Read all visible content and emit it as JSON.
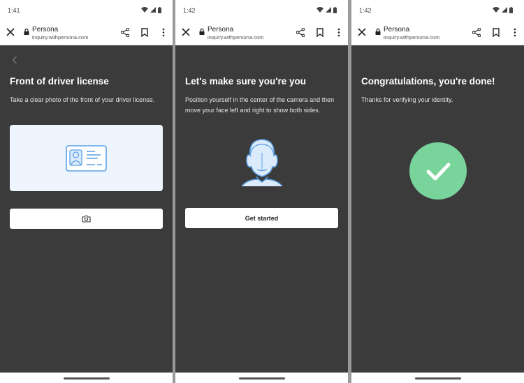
{
  "screens": [
    {
      "time": "1:41",
      "browser": {
        "title": "Persona",
        "url": "inquiry.withpersona.com"
      },
      "heading": "Front of driver license",
      "body": "Take a clear photo of the front of your driver license.",
      "illustration": "id-card-icon",
      "action_icon": "camera-icon"
    },
    {
      "time": "1:42",
      "browser": {
        "title": "Persona",
        "url": "inquiry.withpersona.com"
      },
      "heading": "Let's make sure you're you",
      "body": "Position yourself in the center of the camera and then move your face left and right to show both sides.",
      "illustration": "face-icon",
      "button_label": "Get started"
    },
    {
      "time": "1:42",
      "browser": {
        "title": "Persona",
        "url": "inquiry.withpersona.com"
      },
      "heading": "Congratulations, you're done!",
      "body": "Thanks for verifying your identity.",
      "illustration": "check-circle-icon"
    }
  ],
  "colors": {
    "panel_background": "#3b3b3b",
    "divider": "#9a9a9a",
    "card_background": "#eef5ff",
    "illustration_blue": "#5aa0e6",
    "success_green": "#79d49b"
  }
}
